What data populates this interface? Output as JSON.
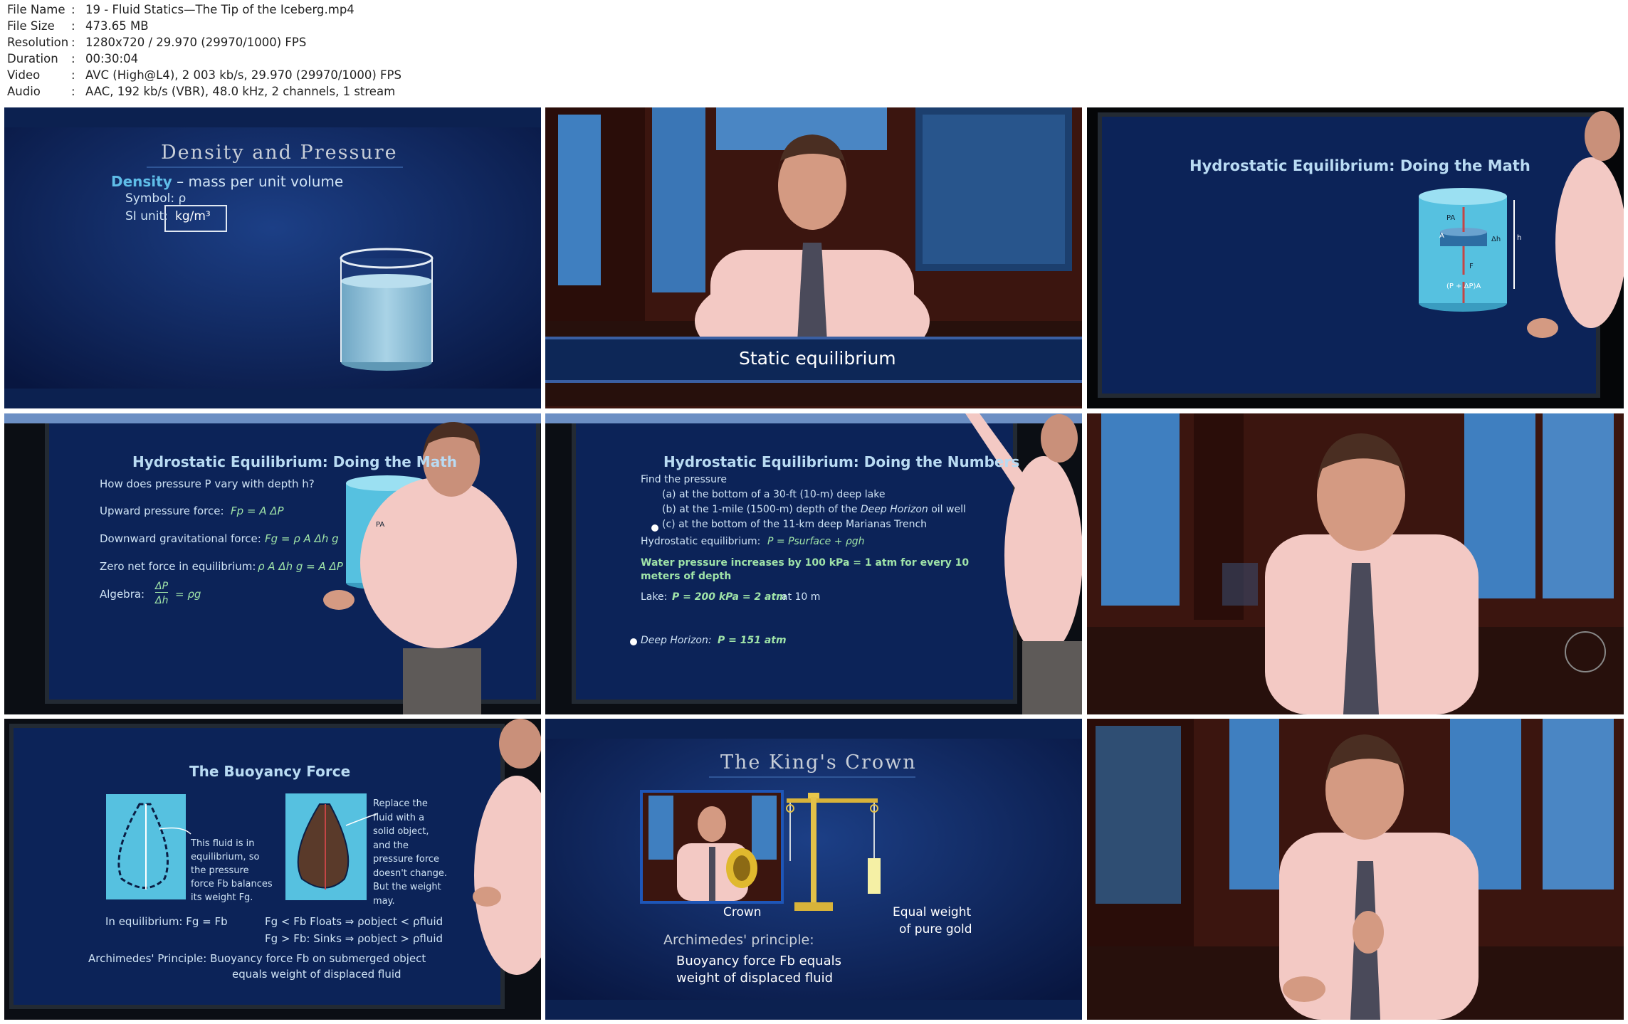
{
  "file_info": [
    {
      "label": "File Name",
      "value": "19 - Fluid Statics—The Tip of the Iceberg.mp4"
    },
    {
      "label": "File Size",
      "value": "473.65 MB"
    },
    {
      "label": "Resolution",
      "value": "1280x720 / 29.970 (29970/1000) FPS"
    },
    {
      "label": "Duration",
      "value": "00:30:04"
    },
    {
      "label": "Video",
      "value": "AVC (High@L4), 2 003 kb/s, 29.970 (29970/1000) FPS"
    },
    {
      "label": "Audio",
      "value": "AAC, 192 kb/s (VBR), 48.0 kHz, 2 channels, 1 stream"
    }
  ],
  "frames": {
    "f1": {
      "title": "Density and Pressure",
      "line1_bold": "Density",
      "line1_rest": " – mass per unit volume",
      "symbol": "Symbol: ρ",
      "si_label": "SI unit:",
      "si_value": "kg/m³"
    },
    "f2": {
      "caption": "Static equilibrium"
    },
    "f3": {
      "title": "Hydrostatic Equilibrium: Doing the Math",
      "lbl_pa": "PA",
      "lbl_a": "A",
      "lbl_dh": "Δh",
      "lbl_h": "h",
      "lbl_f": "F",
      "lbl_bottom": "(P + ΔP)A"
    },
    "f4": {
      "title": "Hydrostatic Equilibrium: Doing the Math",
      "q": "How does pressure P vary with depth h?",
      "l1": "Upward pressure force:",
      "l1e": "Fp = A ΔP",
      "l2": "Downward gravitational force:",
      "l2e": "Fg = ρ A Δh g",
      "l3": "Zero net force in equilibrium:",
      "l3e": "ρ A Δh g = A ΔP",
      "l4": "Algebra:",
      "l4num": "ΔP",
      "l4den": "Δh",
      "l4e": "= ρg",
      "lbl_pa": "PA"
    },
    "f5": {
      "title": "Hydrostatic Equilibrium: Doing the Numbers",
      "find": "Find the pressure",
      "a": "(a) at the bottom of a 30-ft (10-m) deep lake",
      "b_pre": "(b) at the 1-mile (1500-m) depth of the ",
      "b_it": "Deep Horizon",
      "b_post": " oil well",
      "c": "(c) at the bottom of the 11-km deep Marianas Trench",
      "he_label": "Hydrostatic equilibrium:",
      "he_eq": "P = Psurface + ρgh",
      "water1": "Water pressure increases by 100 kPa = 1 atm for every 10",
      "water2": "meters of depth",
      "lake_label": "Lake:",
      "lake_eq": "P = 200 kPa = 2 atm",
      "lake_post": "at 10 m",
      "dh_label": "Deep Horizon:",
      "dh_eq": "P = 151 atm"
    },
    "f7": {
      "title": "The Buoyancy Force",
      "note1": [
        "This fluid is in",
        "equilibrium, so",
        "the pressure",
        "force Fb balances",
        "its weight Fg."
      ],
      "note2": [
        "Replace the",
        "fluid with a",
        "solid object,",
        "and the",
        "pressure force",
        "doesn't change.",
        "But the weight",
        "may."
      ],
      "eq1": "In equilibrium: Fg = Fb",
      "floats": "Fg < Fb  Floats ⇒ ρobject < ρfluid",
      "sinks": "Fg > Fb: Sinks ⇒ ρobject > ρfluid",
      "arch1": "Archimedes' Principle:   Buoyancy force Fb on submerged object",
      "arch2": "equals weight of displaced fluid"
    },
    "f8": {
      "title": "The King's Crown",
      "crown": "Crown",
      "gold1": "Equal weight",
      "gold2": "of pure gold",
      "principle": "Archimedes' principle:",
      "b1": "Buoyancy force Fb equals",
      "b2": "weight of displaced fluid"
    }
  },
  "colors": {
    "slide_bg": "#0c2358",
    "slide_blue_text": "#b9dbf3",
    "green_text": "#9fe3a8",
    "shirt": "#f3c9c4",
    "wood": "#4a1c16",
    "window_blue": "#3f7fc0"
  }
}
